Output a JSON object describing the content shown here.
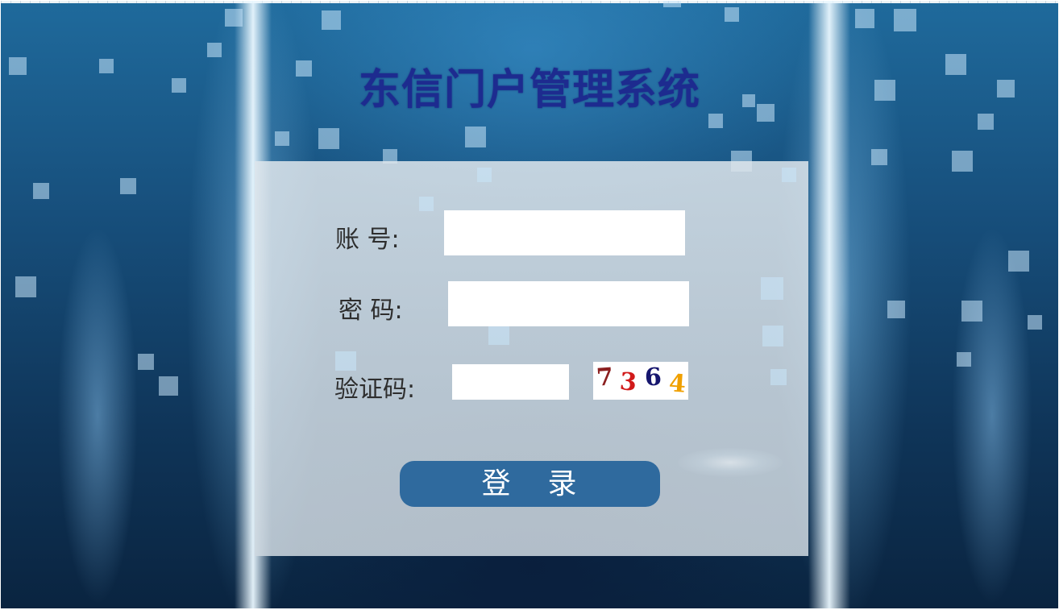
{
  "app": {
    "title": "东信门户管理系统"
  },
  "login_form": {
    "account_label": "账 号:",
    "account_value": "",
    "password_label": "密 码:",
    "password_value": "",
    "captcha_label": "验证码:",
    "captcha_value": "",
    "captcha_chars": [
      {
        "char": "7",
        "color": "#8b1f1f"
      },
      {
        "char": "3",
        "color": "#d11a1a"
      },
      {
        "char": "6",
        "color": "#16166e"
      },
      {
        "char": "4",
        "color": "#f0a000"
      }
    ],
    "login_button_chars": [
      "登",
      "录"
    ]
  },
  "theme": {
    "title_color": "#1d2b8f",
    "button_color": "#2f6a9e",
    "background_color": "#174f7c"
  }
}
